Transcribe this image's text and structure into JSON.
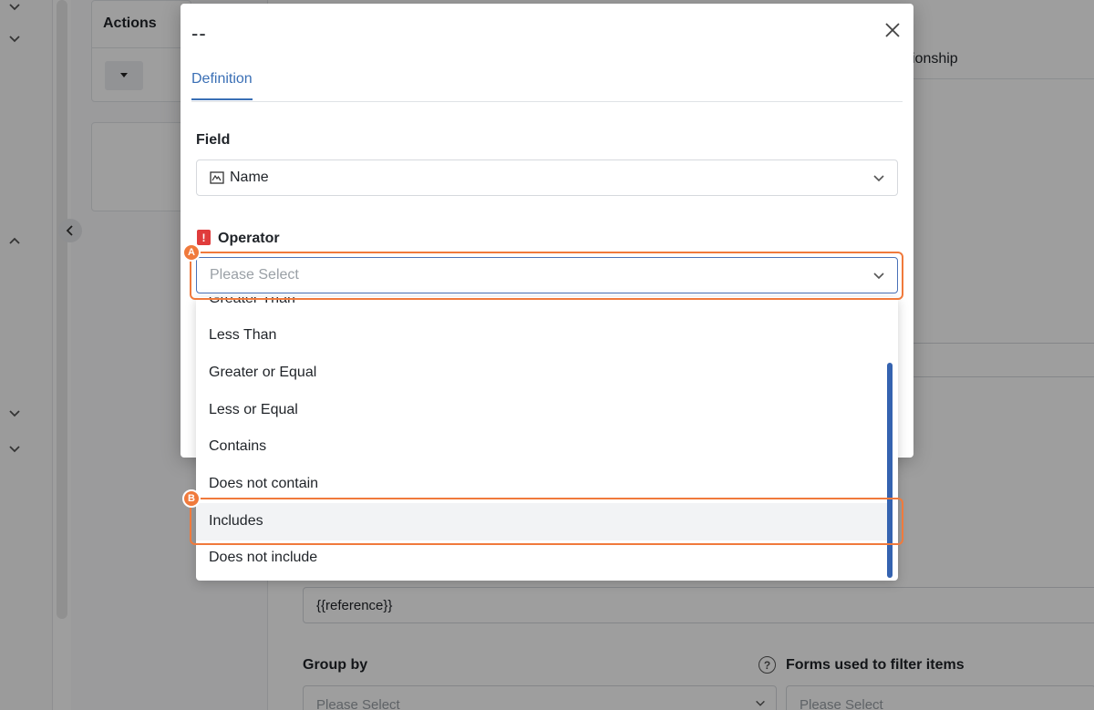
{
  "background": {
    "actions_header": "Actions",
    "relationship_text": "ionship",
    "reference_value": "{{reference}}",
    "group_by_label": "Group by",
    "forms_filter_label": "Forms used to filter items",
    "group_by_placeholder": "Please Select",
    "forms_filter_placeholder": "Please Select"
  },
  "modal": {
    "title": "--",
    "tabs": [
      {
        "label": "Definition",
        "active": true
      }
    ],
    "field": {
      "label": "Field",
      "value": "Name",
      "icon": "text-field-icon"
    },
    "operator": {
      "label": "Operator",
      "placeholder": "Please Select",
      "required": true
    },
    "operator_options": [
      "Greater Than",
      "Less Than",
      "Greater or Equal",
      "Less or Equal",
      "Contains",
      "Does not contain",
      "Includes",
      "Does not include"
    ],
    "hovered_option": "Includes"
  },
  "annotations": {
    "a": "A",
    "b": "B"
  },
  "colors": {
    "accent": "#3a6fb5",
    "highlight": "#f07a3c",
    "required": "#e03c3c"
  }
}
